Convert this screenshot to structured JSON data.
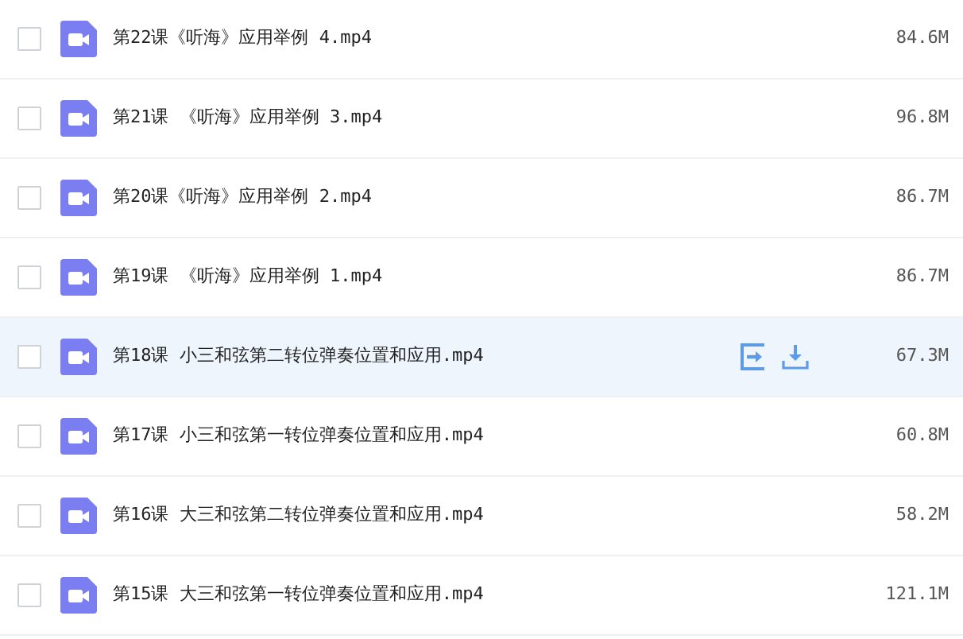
{
  "files": [
    {
      "name": "第22课《听海》应用举例 4.mp4",
      "size": "84.6M",
      "checked": false,
      "highlighted": false
    },
    {
      "name": "第21课 《听海》应用举例 3.mp4",
      "size": "96.8M",
      "checked": false,
      "highlighted": false
    },
    {
      "name": "第20课《听海》应用举例 2.mp4",
      "size": "86.7M",
      "checked": false,
      "highlighted": false
    },
    {
      "name": "第19课 《听海》应用举例 1.mp4",
      "size": "86.7M",
      "checked": false,
      "highlighted": false
    },
    {
      "name": "第18课 小三和弦第二转位弹奏位置和应用.mp4",
      "size": "67.3M",
      "checked": false,
      "highlighted": true
    },
    {
      "name": "第17课 小三和弦第一转位弹奏位置和应用.mp4",
      "size": "60.8M",
      "checked": false,
      "highlighted": false
    },
    {
      "name": "第16课 大三和弦第二转位弹奏位置和应用.mp4",
      "size": "58.2M",
      "checked": false,
      "highlighted": false
    },
    {
      "name": "第15课 大三和弦第一转位弹奏位置和应用.mp4",
      "size": "121.1M",
      "checked": false,
      "highlighted": false
    }
  ]
}
